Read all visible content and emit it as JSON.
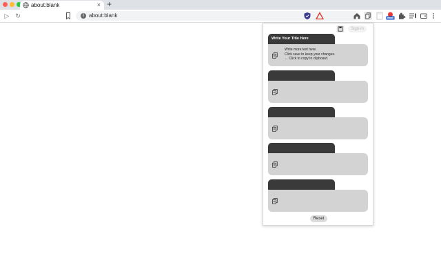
{
  "browser": {
    "tab_title": "about:blank",
    "tab_close": "×",
    "new_tab": "+",
    "url": "about:blank",
    "info_icon": "i",
    "colors": {
      "tabstrip": "#dee1e6",
      "omnibox": "#f1f3f4"
    }
  },
  "toolbar": {
    "back": "▷",
    "reload": "↻"
  },
  "popup": {
    "signin_label": "Sign-in",
    "reset_label": "Reset",
    "notes": [
      {
        "title": "Write Your Title Here",
        "text": "Write more text here.\nClick save to keep your changes.\n← Click to copy to clipboard."
      },
      {
        "title": "",
        "text": ""
      },
      {
        "title": "",
        "text": ""
      },
      {
        "title": "",
        "text": ""
      },
      {
        "title": "",
        "text": ""
      }
    ],
    "colors": {
      "note_header": "#3a3a3a",
      "note_body": "#d3d3d3"
    }
  }
}
